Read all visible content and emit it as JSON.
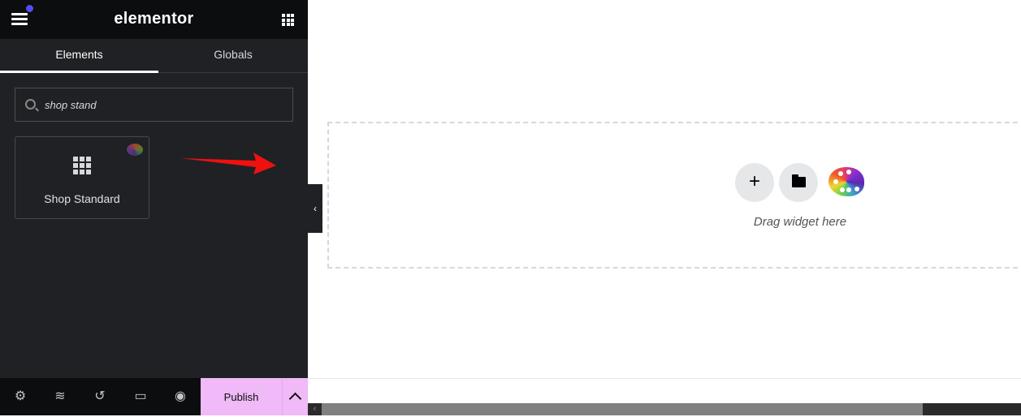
{
  "header": {
    "logo": "elementor",
    "notification_color": "#524cff"
  },
  "tabs": [
    {
      "label": "Elements",
      "active": true
    },
    {
      "label": "Globals",
      "active": false
    }
  ],
  "search": {
    "value": "shop stand"
  },
  "results": [
    {
      "label": "Shop Standard",
      "icon": "grid-icon",
      "badge": "palette-icon"
    }
  ],
  "canvas": {
    "drop_text": "Drag widget here",
    "buttons": [
      "plus-icon",
      "folder-icon",
      "palette-icon"
    ]
  },
  "footer": {
    "icons": [
      "gear-icon",
      "layers-icon",
      "history-icon",
      "responsive-icon",
      "eye-icon"
    ],
    "publish_label": "Publish",
    "accent": "#f0b9f7"
  }
}
